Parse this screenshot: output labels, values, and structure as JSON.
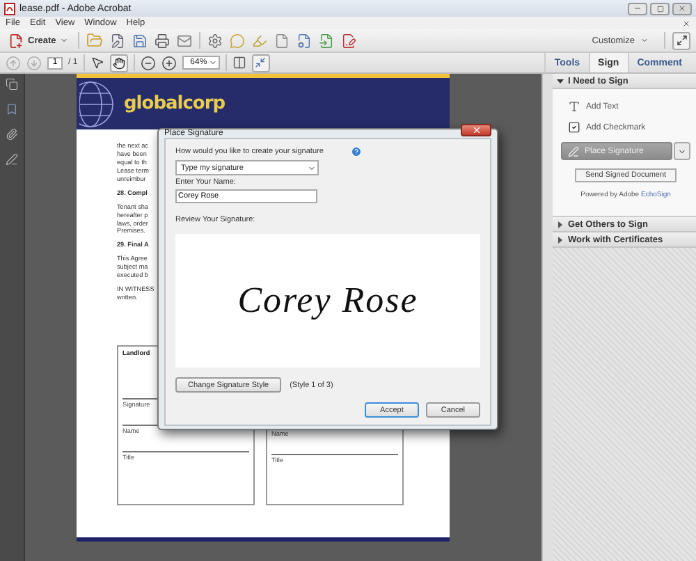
{
  "window": {
    "title": "lease.pdf - Adobe Acrobat"
  },
  "menu": [
    "File",
    "Edit",
    "View",
    "Window",
    "Help"
  ],
  "toolbar": {
    "create_label": "Create",
    "customize_label": "Customize"
  },
  "navigation": {
    "page": "1",
    "page_total": "/ 1",
    "zoom": "64%"
  },
  "panel_tabs": [
    {
      "label": "Tools",
      "selected": false
    },
    {
      "label": "Sign",
      "selected": true
    },
    {
      "label": "Comment",
      "selected": false
    }
  ],
  "sign_panel": {
    "sections": [
      {
        "title": "I Need to Sign",
        "expanded": true
      },
      {
        "title": "Get Others to Sign",
        "expanded": false
      },
      {
        "title": "Work with Certificates",
        "expanded": false
      }
    ],
    "actions": [
      {
        "kind": "text",
        "label": "Add Text"
      },
      {
        "kind": "checkmark",
        "label": "Add Checkmark"
      }
    ],
    "place_signature": "Place Signature",
    "send_button": "Send Signed Document",
    "powered_by": "Powered by Adobe",
    "powered_link": "EchoSign"
  },
  "document": {
    "logo": "globalcorp",
    "paragraphs": [
      {
        "kind": "text",
        "lines": [
          "the next ac",
          "have been",
          "equal to th",
          "Lease term",
          "unreimbur"
        ]
      },
      {
        "kind": "heading",
        "lines": [
          "28. Compl"
        ]
      },
      {
        "kind": "text",
        "lines": [
          "Tenant sha",
          "hereafter p",
          "laws, order",
          "Premises."
        ]
      },
      {
        "kind": "heading",
        "lines": [
          "29. Final A"
        ]
      },
      {
        "kind": "text",
        "lines": [
          "This Agree",
          "subject ma",
          "executed b"
        ]
      },
      {
        "kind": "text",
        "lines": [
          "IN WITNESS",
          "written."
        ]
      }
    ],
    "signature_boxes": [
      {
        "party": "Landlord",
        "fields": [
          "Signature",
          "Name",
          "Title"
        ]
      },
      {
        "fields": [
          "Name",
          "Title"
        ]
      }
    ]
  },
  "dialog": {
    "title": "Place Signature",
    "question": "How would you like to create your signature",
    "method": "Type my signature",
    "name_label": "Enter Your Name:",
    "name_value": "Corey Rose",
    "review_label": "Review Your Signature:",
    "signature": "Corey Rose",
    "style_button": "Change Signature Style",
    "style_note": "(Style 1 of 3)",
    "buttons": [
      {
        "label": "Accept",
        "default": true
      },
      {
        "label": "Cancel",
        "default": false
      }
    ]
  }
}
